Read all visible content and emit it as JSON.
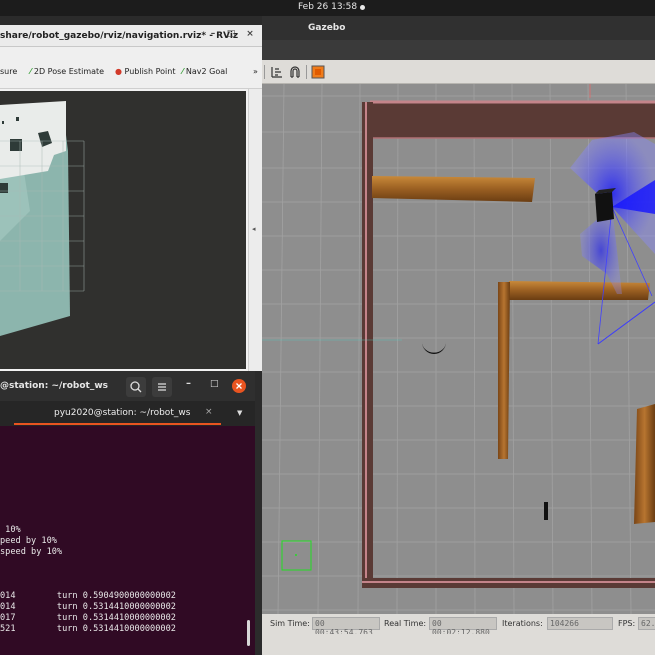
{
  "topbar": {
    "clock": "Feb 26  13:58"
  },
  "rviz": {
    "title": "share/robot_gazebo/rviz/navigation.rviz* - RViz",
    "tools": [
      {
        "label": "sure",
        "icon": "measure-icon"
      },
      {
        "label": "2D Pose Estimate",
        "icon": "pose-arrow-icon"
      },
      {
        "label": "Publish Point",
        "icon": "map-pin-icon"
      },
      {
        "label": "Nav2 Goal",
        "icon": "goal-arrow-icon"
      },
      {
        "label": "»",
        "icon": "overflow-chevron-icon"
      }
    ]
  },
  "gazebo": {
    "title": "Gazebo",
    "status": {
      "sim_time_label": "Sim Time:",
      "sim_time_value": "00 00:43:54.763",
      "real_time_label": "Real Time:",
      "real_time_value": "00 00:02:12.880",
      "iterations_label": "Iterations:",
      "iterations_value": "104266",
      "fps_label": "FPS:",
      "fps_value": "62.4"
    }
  },
  "terminal": {
    "window_title": "@station: ~/robot_ws",
    "tab_title": "pyu2020@station: ~/robot_ws",
    "lines": [
      " 10%",
      "peed by 10%",
      "speed by 10%",
      "014        turn 0.5904900000000002",
      "014        turn 0.5314410000000002",
      "017        turn 0.5314410000000002",
      "521        turn 0.5314410000000002"
    ]
  },
  "colors": {
    "terminal_bg": "#300a24",
    "accent": "#e95420",
    "close_button": "#e95420",
    "scan": "#3a3aff"
  }
}
